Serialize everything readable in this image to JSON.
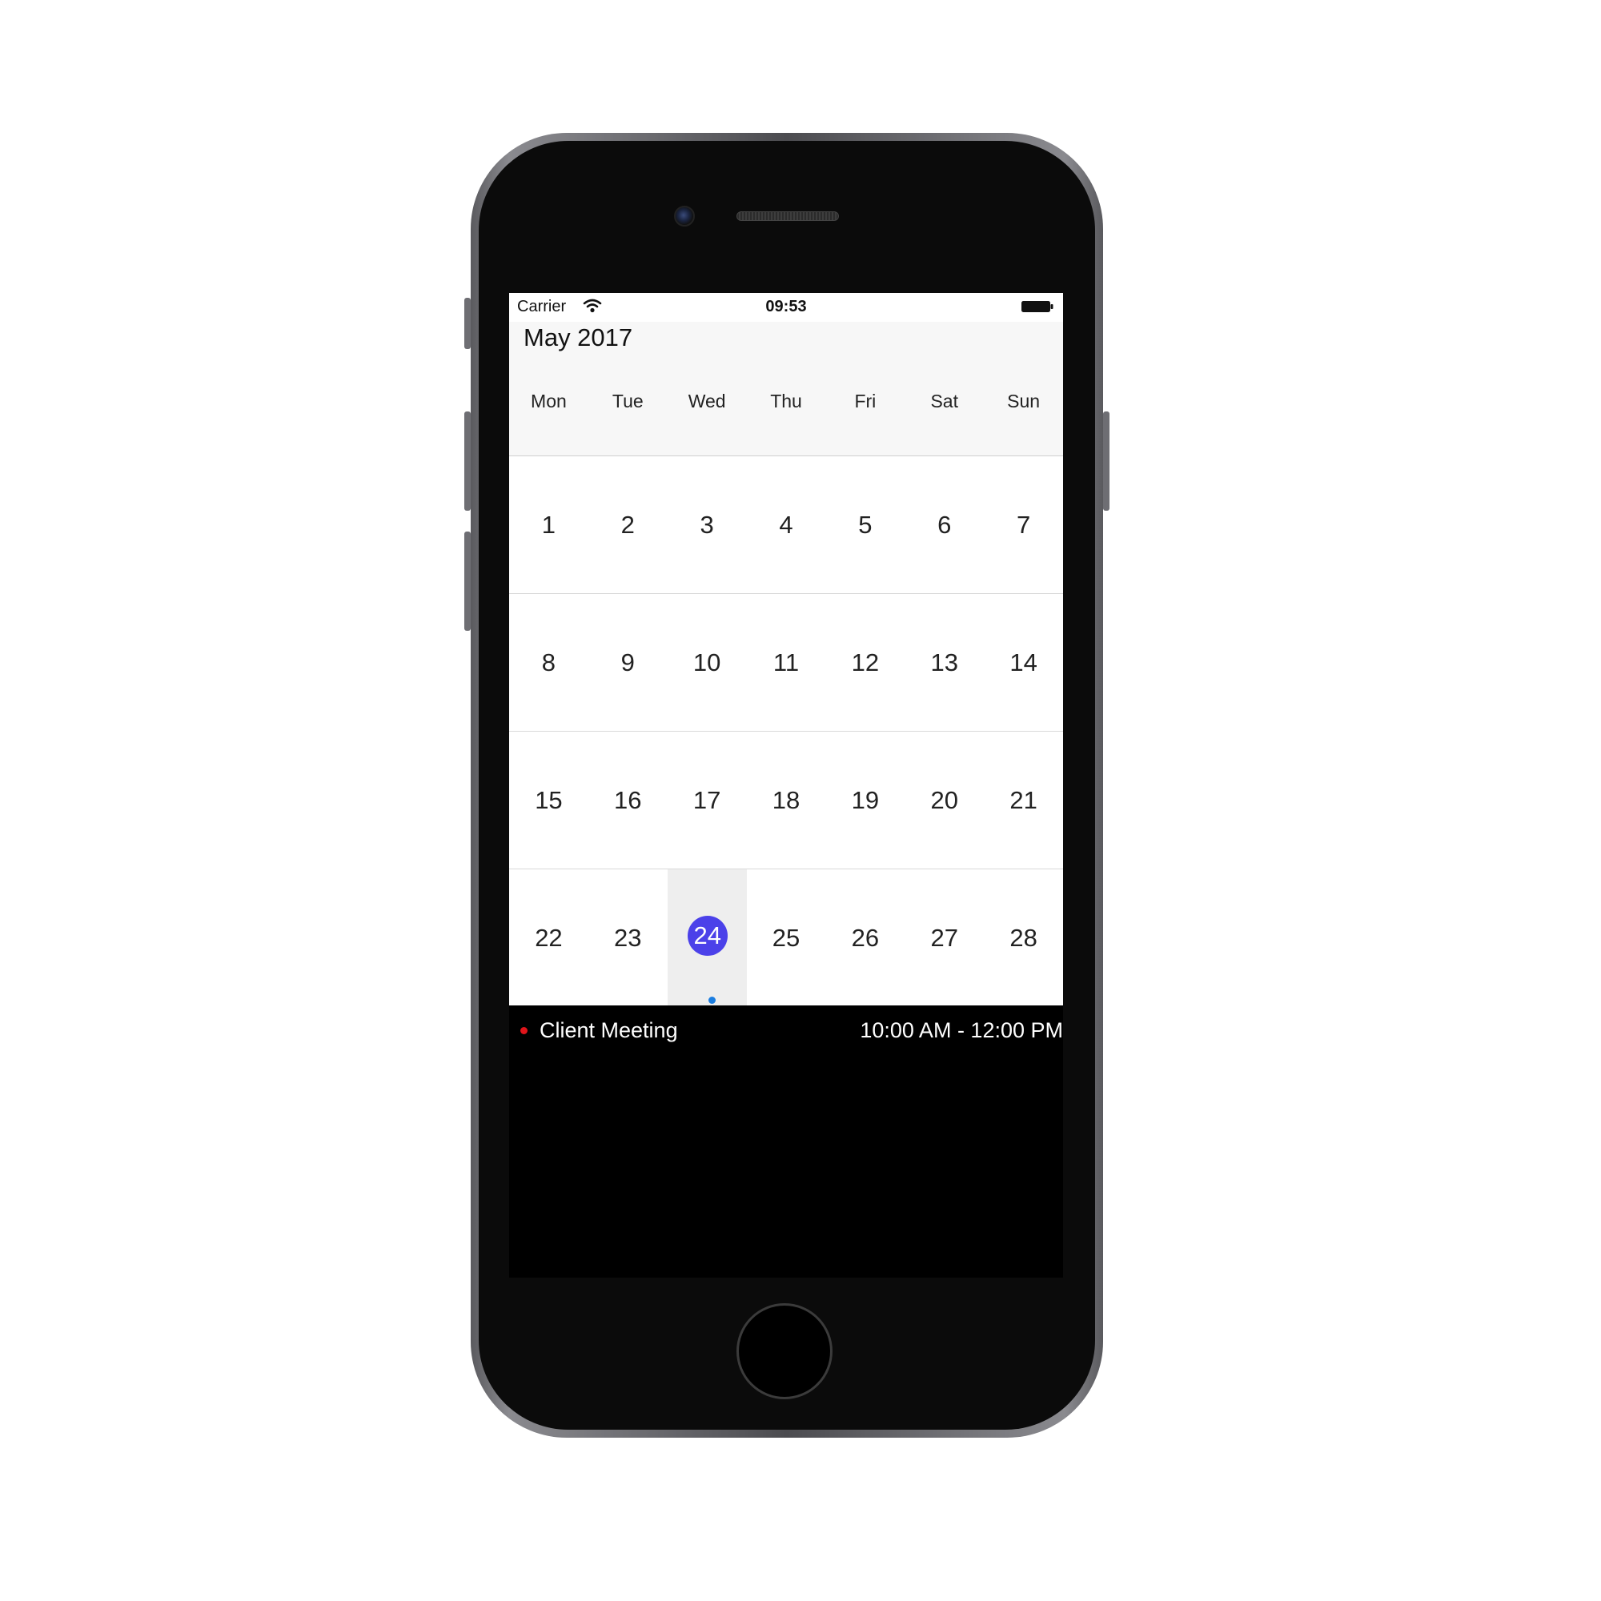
{
  "status_bar": {
    "carrier": "Carrier",
    "time": "09:53",
    "wifi_icon": "wifi-icon",
    "battery_icon": "battery-icon"
  },
  "calendar": {
    "month_title": "May 2017",
    "weekdays": [
      "Mon",
      "Tue",
      "Wed",
      "Thu",
      "Fri",
      "Sat",
      "Sun"
    ],
    "weeks": [
      [
        "1",
        "2",
        "3",
        "4",
        "5",
        "6",
        "7"
      ],
      [
        "8",
        "9",
        "10",
        "11",
        "12",
        "13",
        "14"
      ],
      [
        "15",
        "16",
        "17",
        "18",
        "19",
        "20",
        "21"
      ],
      [
        "22",
        "23",
        "24",
        "25",
        "26",
        "27",
        "28"
      ]
    ],
    "selected_day": "24",
    "selected_color": "#4b41e9",
    "event_indicator_color": "#1a7de0"
  },
  "events": [
    {
      "title": "Client Meeting",
      "time": "10:00 AM - 12:00 PM",
      "color": "#e0141a"
    }
  ],
  "device": {
    "home_button_icon": "home-button",
    "camera_icon": "camera-icon",
    "speaker_icon": "speaker-grille"
  }
}
